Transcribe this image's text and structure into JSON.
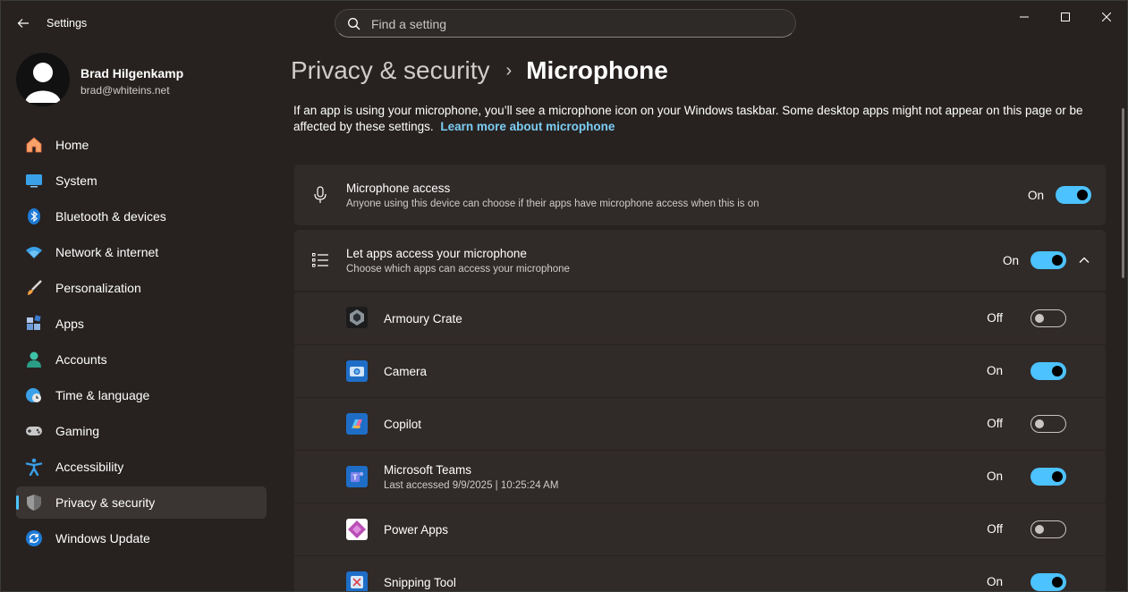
{
  "window": {
    "title": "Settings"
  },
  "search": {
    "placeholder": "Find a setting"
  },
  "profile": {
    "name": "Brad Hilgenkamp",
    "email": "brad@whiteins.net"
  },
  "sidebar": {
    "items": [
      {
        "label": "Home",
        "icon": "home-icon",
        "active": false
      },
      {
        "label": "System",
        "icon": "system-icon",
        "active": false
      },
      {
        "label": "Bluetooth & devices",
        "icon": "bluetooth-icon",
        "active": false
      },
      {
        "label": "Network & internet",
        "icon": "wifi-icon",
        "active": false
      },
      {
        "label": "Personalization",
        "icon": "brush-icon",
        "active": false
      },
      {
        "label": "Apps",
        "icon": "apps-icon",
        "active": false
      },
      {
        "label": "Accounts",
        "icon": "accounts-icon",
        "active": false
      },
      {
        "label": "Time & language",
        "icon": "globe-clock-icon",
        "active": false
      },
      {
        "label": "Gaming",
        "icon": "gamepad-icon",
        "active": false
      },
      {
        "label": "Accessibility",
        "icon": "accessibility-icon",
        "active": false
      },
      {
        "label": "Privacy & security",
        "icon": "shield-icon",
        "active": true
      },
      {
        "label": "Windows Update",
        "icon": "update-icon",
        "active": false
      }
    ]
  },
  "breadcrumb": {
    "parent": "Privacy & security",
    "separator": "›",
    "current": "Microphone"
  },
  "description": {
    "text": "If an app is using your microphone, you’ll see a microphone icon on your Windows taskbar. Some desktop apps might not appear on this page or be affected by these settings.",
    "link": "Learn more about microphone"
  },
  "microphone_access": {
    "title": "Microphone access",
    "subtitle": "Anyone using this device can choose if their apps have microphone access when this is on",
    "state": "On"
  },
  "let_apps_access": {
    "title": "Let apps access your microphone",
    "subtitle": "Choose which apps can access your microphone",
    "state": "On"
  },
  "apps": [
    {
      "name": "Armoury Crate",
      "sub": "",
      "state": "Off",
      "icon": "armoury-crate-icon"
    },
    {
      "name": "Camera",
      "sub": "",
      "state": "On",
      "icon": "camera-icon"
    },
    {
      "name": "Copilot",
      "sub": "",
      "state": "Off",
      "icon": "copilot-icon"
    },
    {
      "name": "Microsoft Teams",
      "sub": "Last accessed 9/9/2025  |  10:25:24 AM",
      "state": "On",
      "icon": "teams-icon"
    },
    {
      "name": "Power Apps",
      "sub": "",
      "state": "Off",
      "icon": "power-apps-icon"
    },
    {
      "name": "Snipping Tool",
      "sub": "",
      "state": "On",
      "icon": "snipping-tool-icon"
    }
  ],
  "colors": {
    "accent": "#4cc2ff",
    "background": "#272220",
    "card": "#302a28",
    "link": "#7ccdf4"
  }
}
